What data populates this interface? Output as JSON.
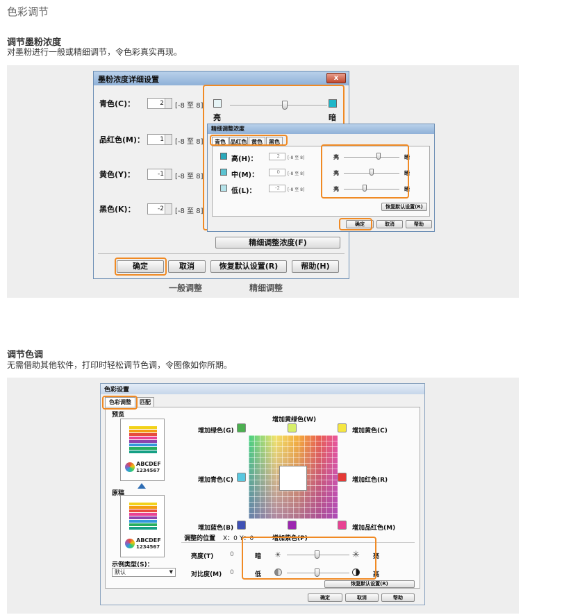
{
  "page": {
    "title": "色彩调节"
  },
  "section1": {
    "heading": "调节墨粉浓度",
    "desc": "对墨粉进行一般或精细调节，令色彩真实再现。",
    "dialog": {
      "title": "墨粉浓度详细设置",
      "close": "x",
      "rows": [
        {
          "label": "青色(C)：",
          "value": "2",
          "range": "[-8 至 8]"
        },
        {
          "label": "品红色(M)：",
          "value": "1",
          "range": "[-8 至 8]"
        },
        {
          "label": "黄色(Y)：",
          "value": "-1",
          "range": "[-8 至 8]"
        },
        {
          "label": "黑色(K)：",
          "value": "-2",
          "range": "[-8 至 8]"
        }
      ],
      "slider": {
        "light": "亮",
        "dark": "暗"
      },
      "fine_button": "精细调整浓度(F)",
      "ok": "确定",
      "cancel": "取消",
      "restore": "恢复默认设置(R)",
      "help": "帮助(H)"
    },
    "fine_dialog": {
      "title": "精细调整浓度",
      "tabs": [
        "青色",
        "品红色",
        "黄色",
        "黑色"
      ],
      "rows": [
        {
          "label": "高(H)：",
          "value": "2",
          "range": "[-8 至 8]"
        },
        {
          "label": "中(M)：",
          "value": "0",
          "range": "[-8 至 8]"
        },
        {
          "label": "低(L)：",
          "value": "-2",
          "range": "[-8 至 8]"
        }
      ],
      "light": "亮",
      "dark": "暗",
      "restore": "恢复默认设置(R)",
      "ok": "确定",
      "cancel": "取消",
      "help": "帮助"
    },
    "captions": {
      "general": "一般调整",
      "fine": "精细调整"
    }
  },
  "section2": {
    "heading": "调节色调",
    "desc": "无需借助其他软件，打印时轻松调节色调，令图像如你所期。",
    "dialog": {
      "title": "色彩设置",
      "tabs": [
        "色彩调整",
        "匹配"
      ],
      "preview_label": "预览",
      "original_label": "原稿",
      "sample_text": "ABCDEF",
      "sample_num": "1234567",
      "sample_type_label": "示例类型(S)：",
      "sample_type_value": "默认",
      "directions": {
        "yellow_green": "增加黄绿色(W)",
        "green": "增加绿色(G)",
        "yellow": "增加黄色(C)",
        "cyan": "增加青色(C)",
        "red": "增加红色(R)",
        "blue": "增加蓝色(B)",
        "purple": "增加紫色(P)",
        "magenta": "增加品红色(M)"
      },
      "position_label": "调整的位置",
      "position_x": "X：0",
      "position_y": "Y：0",
      "brightness_label": "亮度(T)",
      "brightness_value": "0",
      "brightness_dark": "暗",
      "brightness_light": "亮",
      "contrast_label": "对比度(M)",
      "contrast_value": "0",
      "contrast_low": "低",
      "contrast_high": "高",
      "restore": "恢复默认设置(R)",
      "ok": "确定",
      "cancel": "取消",
      "help": "帮助"
    }
  },
  "colors": {
    "highlight": "#f08a24",
    "titlebar": "#8fb1d8",
    "panel_bg": "#eeeeee"
  }
}
